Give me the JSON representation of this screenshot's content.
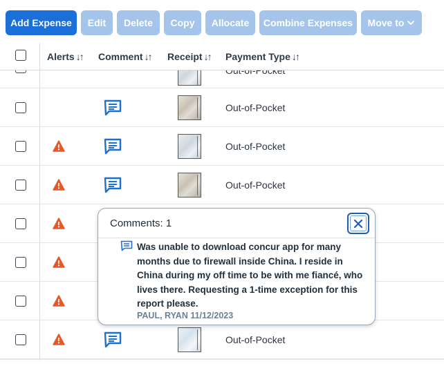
{
  "toolbar": {
    "add_expense": "Add Expense",
    "edit": "Edit",
    "delete": "Delete",
    "copy": "Copy",
    "allocate": "Allocate",
    "combine_expenses": "Combine Expenses",
    "move_to": "Move to"
  },
  "table": {
    "columns": {
      "alerts": "Alerts",
      "comment": "Comment",
      "receipt": "Receipt",
      "payment_type": "Payment Type"
    },
    "partial_row_payment": "Out-of-Pocket",
    "rows": [
      {
        "alert": false,
        "comment": true,
        "payment_type": "Out-of-Pocket"
      },
      {
        "alert": true,
        "comment": true,
        "payment_type": "Out-of-Pocket"
      },
      {
        "alert": true,
        "comment": true,
        "payment_type": "Out-of-Pocket"
      },
      {
        "alert": true,
        "comment": false,
        "payment_type": ""
      },
      {
        "alert": true,
        "comment": false,
        "payment_type": ""
      },
      {
        "alert": true,
        "comment": false,
        "payment_type": ""
      },
      {
        "alert": true,
        "comment": true,
        "payment_type": "Out-of-Pocket"
      }
    ]
  },
  "popover": {
    "title": "Comments: 1",
    "comment_text": "Was unable to download concur app for many months due to firewall inside China. I reside in China during my off time to be with me fiancé, who lives there. Requesting a 1-time exception for this report please.",
    "author": "PAUL, RYAN 11/12/2023"
  },
  "colors": {
    "primary": "#1b6fd8",
    "disabled": "#a5c4ea",
    "alert": "#e8572a",
    "comment_icon": "#1b6fd8"
  }
}
